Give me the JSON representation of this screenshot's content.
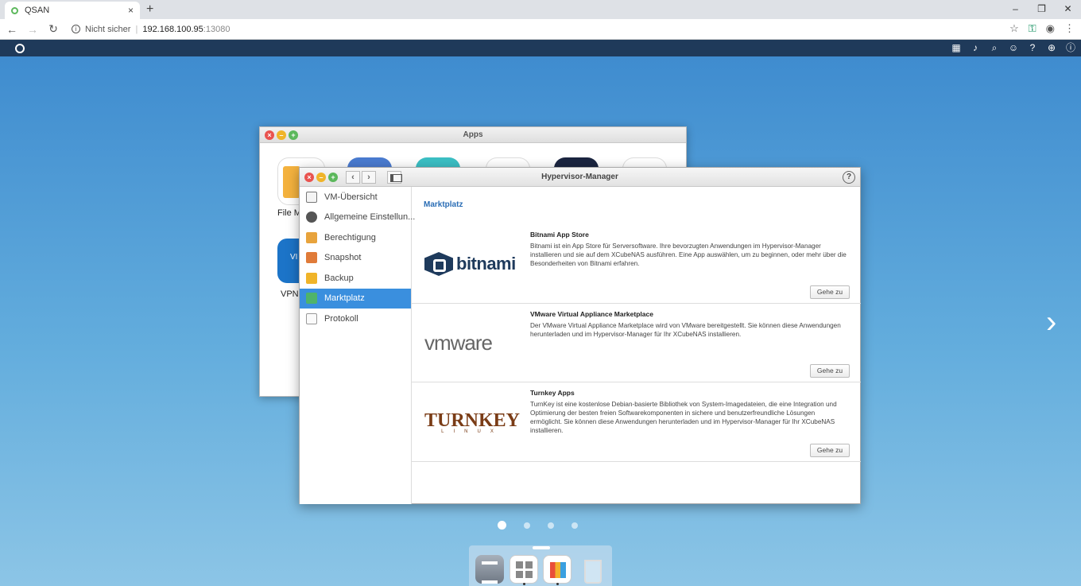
{
  "browser": {
    "tab_title": "QSAN",
    "tab_close": "×",
    "new_tab": "+",
    "security_label": "Nicht sicher",
    "url_host": "192.168.100.95",
    "url_port": ":13080",
    "window_controls": [
      "–",
      "❐",
      "✕"
    ]
  },
  "apps_window": {
    "title": "Apps",
    "apps": [
      {
        "label": "File M"
      },
      {
        "label": "VPN-"
      }
    ]
  },
  "hypervisor": {
    "title": "Hypervisor-Manager",
    "help": "?",
    "nav_back": "‹",
    "nav_fwd": "›",
    "sidebar": [
      {
        "label": "VM-Übersicht",
        "icon": "vm-overview-icon"
      },
      {
        "label": "Allgemeine Einstellun...",
        "icon": "general-settings-icon"
      },
      {
        "label": "Berechtigung",
        "icon": "permission-icon"
      },
      {
        "label": "Snapshot",
        "icon": "snapshot-icon"
      },
      {
        "label": "Backup",
        "icon": "backup-icon"
      },
      {
        "label": "Marktplatz",
        "icon": "marketplace-icon",
        "active": true
      },
      {
        "label": "Protokoll",
        "icon": "log-icon"
      }
    ],
    "main": {
      "heading": "Marktplatz",
      "cards": [
        {
          "title": "Bitnami App Store",
          "text": "Bitnami ist ein App Store für Serversoftware. Ihre bevorzugten Anwendungen im Hypervisor-Manager installieren und sie auf dem XCubeNAS ausführen. Eine App auswählen, um zu beginnen, oder mehr über die Besonderheiten von Bitnami erfahren.",
          "button": "Gehe zu",
          "logo_text": "bitnami"
        },
        {
          "title": "VMware Virtual Appliance Marketplace",
          "text": "Der VMware Virtual Appliance Marketplace wird von VMware bereitgestellt. Sie können diese Anwendungen herunterladen und im Hypervisor-Manager für Ihr XCubeNAS installieren.",
          "button": "Gehe zu",
          "logo_text": "vmware"
        },
        {
          "title": "Turnkey Apps",
          "text": "TurnKey ist eine kostenlose Debian-basierte Bibliothek von System-Imagedateien, die eine Integration und Optimierung der besten freien Softwarekomponenten in sichere und benutzerfreundliche Lösungen ermöglicht. Sie können diese Anwendungen herunterladen und im Hypervisor-Manager für Ihr XCubeNAS installieren.",
          "button": "Gehe zu",
          "logo_text": "TURNKEY",
          "logo_sub": "LINUX"
        }
      ]
    }
  },
  "desktop": {
    "next_arrow": "›",
    "page_count": 4,
    "active_page": 1
  },
  "colors": {
    "accent": "#3a8fde",
    "topbar": "#1f3a5a"
  }
}
